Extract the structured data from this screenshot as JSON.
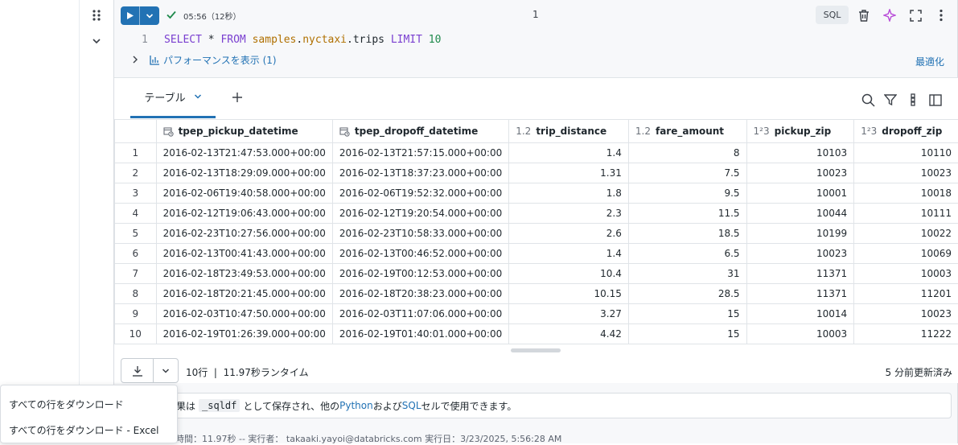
{
  "cell": {
    "runtime": "05:56（12秒）",
    "cell_number": "1",
    "language_badge": "SQL",
    "code": {
      "line_number": "1",
      "tokens": [
        {
          "text": "SELECT",
          "kind": "kw"
        },
        {
          "text": " * ",
          "kind": "plain"
        },
        {
          "text": "FROM",
          "kind": "kw"
        },
        {
          "text": " ",
          "kind": "plain"
        },
        {
          "text": "samples",
          "kind": "tbl"
        },
        {
          "text": ".",
          "kind": "plain"
        },
        {
          "text": "nyctaxi",
          "kind": "tbl"
        },
        {
          "text": ".trips ",
          "kind": "plain"
        },
        {
          "text": "LIMIT",
          "kind": "kw"
        },
        {
          "text": " ",
          "kind": "plain"
        },
        {
          "text": "10",
          "kind": "num"
        }
      ]
    },
    "performance_link": "パフォーマンスを表示 (1)",
    "optimize_link": "最適化"
  },
  "results": {
    "active_tab": "テーブル",
    "columns": [
      {
        "name": "tpep_pickup_datetime",
        "type_icon": "calendar-clock-icon",
        "type_label": ""
      },
      {
        "name": "tpep_dropoff_datetime",
        "type_icon": "calendar-clock-icon",
        "type_label": ""
      },
      {
        "name": "trip_distance",
        "type_icon": "decimal-type-icon",
        "type_label": "1.2"
      },
      {
        "name": "fare_amount",
        "type_icon": "decimal-type-icon",
        "type_label": "1.2"
      },
      {
        "name": "pickup_zip",
        "type_icon": "integer-type-icon",
        "type_label": "1²3"
      },
      {
        "name": "dropoff_zip",
        "type_icon": "integer-type-icon",
        "type_label": "1²3"
      }
    ],
    "rows": [
      [
        "1",
        "2016-02-13T21:47:53.000+00:00",
        "2016-02-13T21:57:15.000+00:00",
        "1.4",
        "8",
        "10103",
        "10110"
      ],
      [
        "2",
        "2016-02-13T18:29:09.000+00:00",
        "2016-02-13T18:37:23.000+00:00",
        "1.31",
        "7.5",
        "10023",
        "10023"
      ],
      [
        "3",
        "2016-02-06T19:40:58.000+00:00",
        "2016-02-06T19:52:32.000+00:00",
        "1.8",
        "9.5",
        "10001",
        "10018"
      ],
      [
        "4",
        "2016-02-12T19:06:43.000+00:00",
        "2016-02-12T19:20:54.000+00:00",
        "2.3",
        "11.5",
        "10044",
        "10111"
      ],
      [
        "5",
        "2016-02-23T10:27:56.000+00:00",
        "2016-02-23T10:58:33.000+00:00",
        "2.6",
        "18.5",
        "10199",
        "10022"
      ],
      [
        "6",
        "2016-02-13T00:41:43.000+00:00",
        "2016-02-13T00:46:52.000+00:00",
        "1.4",
        "6.5",
        "10023",
        "10069"
      ],
      [
        "7",
        "2016-02-18T23:49:53.000+00:00",
        "2016-02-19T00:12:53.000+00:00",
        "10.4",
        "31",
        "11371",
        "10003"
      ],
      [
        "8",
        "2016-02-18T20:21:45.000+00:00",
        "2016-02-18T20:38:23.000+00:00",
        "10.15",
        "28.5",
        "11371",
        "11201"
      ],
      [
        "9",
        "2016-02-03T10:47:50.000+00:00",
        "2016-02-03T11:07:06.000+00:00",
        "3.27",
        "15",
        "10014",
        "10023"
      ],
      [
        "10",
        "2016-02-19T01:26:39.000+00:00",
        "2016-02-19T01:40:01.000+00:00",
        "4.42",
        "15",
        "10003",
        "11222"
      ]
    ],
    "row_info": "10行  |  11.97秒ランタイム",
    "updated": "5 分前更新済み"
  },
  "info": {
    "prefix": "果は",
    "var_name": "_sqldf",
    "mid": "として保存され、他の",
    "python": "Python",
    "and": "および",
    "sql": "SQL",
    "suffix": "セルで使用できます。"
  },
  "footer": "時間：11.97秒 -- 実行者： takaaki.yayoi@databricks.com 実行日：3/23/2025, 5:56:28 AM",
  "download_menu": {
    "items": [
      "すべての行をダウンロード",
      "すべての行をダウンロード - Excel"
    ]
  },
  "colors": {
    "accent": "#2272b4",
    "success": "#1f8a4c",
    "ai": "#b84bd8"
  }
}
